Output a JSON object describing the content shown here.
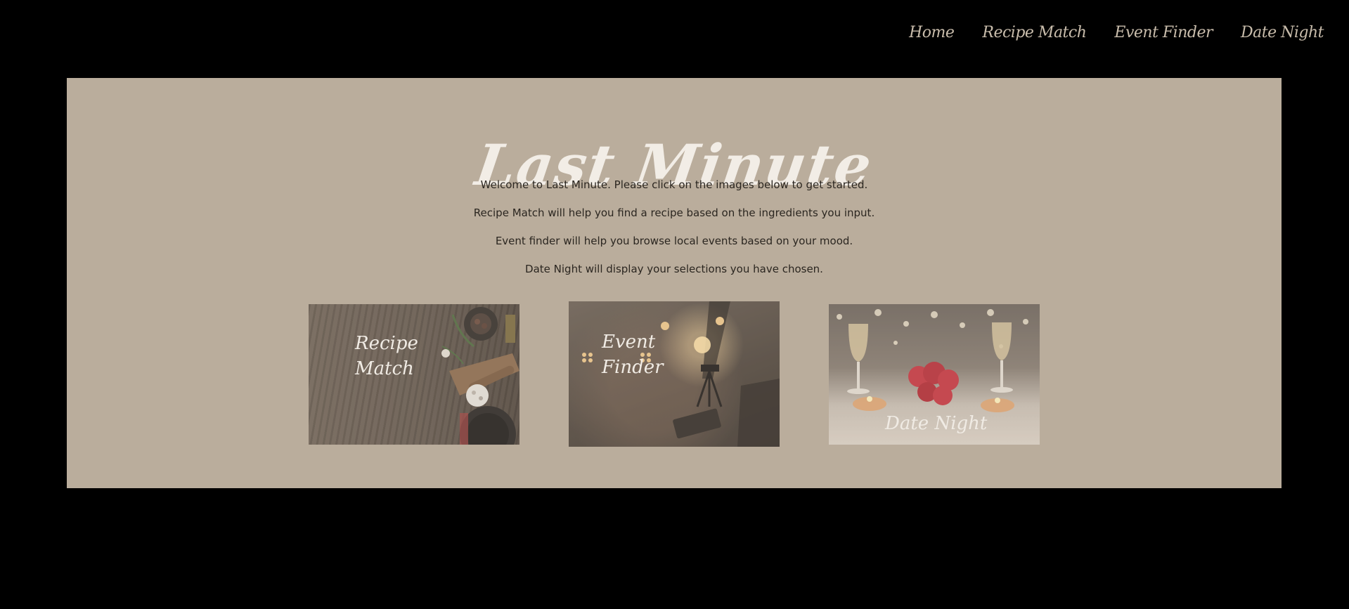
{
  "nav": {
    "items": [
      {
        "label": "Home"
      },
      {
        "label": "Recipe Match"
      },
      {
        "label": "Event Finder"
      },
      {
        "label": "Date Night"
      }
    ]
  },
  "hero": {
    "title": "Last Minute",
    "paragraphs": [
      "Welcome to Last Minute. Please click on the images below to get started.",
      "Recipe Match will help you find a recipe based on the ingredients you input.",
      "Event finder will help you browse local events based on your mood.",
      "Date Night will display your selections you have chosen."
    ]
  },
  "cards": [
    {
      "label_line1": "Recipe",
      "label_line2": "Match"
    },
    {
      "label_line1": "Event",
      "label_line2": "Finder"
    },
    {
      "label_line1": "Date Night",
      "label_line2": ""
    }
  ],
  "colors": {
    "page_background": "#000000",
    "panel_background": "#baad9c",
    "nav_text": "#c8bcab",
    "title_text": "#f2ede6",
    "body_text": "#2b2620"
  }
}
